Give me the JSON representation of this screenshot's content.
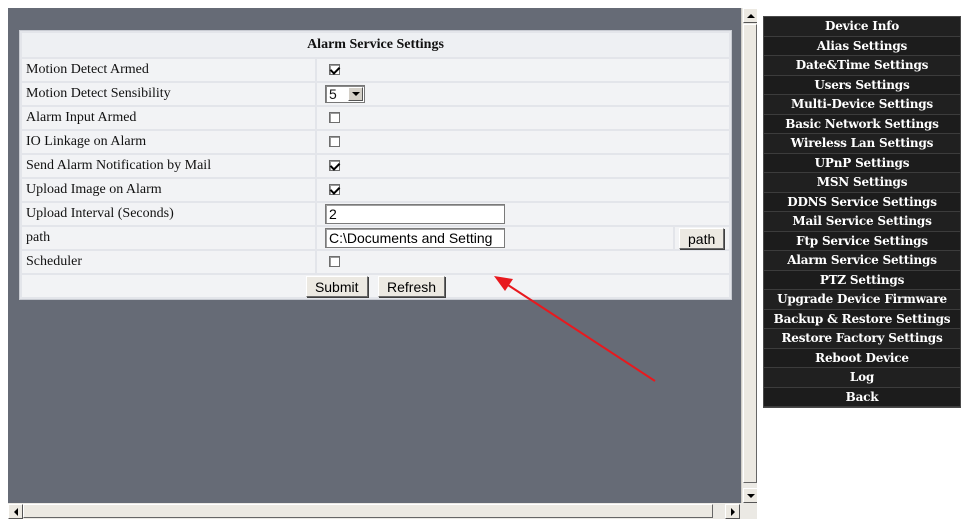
{
  "form": {
    "title": "Alarm Service Settings",
    "rows": {
      "motion_armed": {
        "label": "Motion Detect Armed",
        "checked": true
      },
      "sensibility": {
        "label": "Motion Detect Sensibility",
        "value": "5"
      },
      "alarm_input": {
        "label": "Alarm Input Armed",
        "checked": false
      },
      "io_linkage": {
        "label": "IO Linkage on Alarm",
        "checked": false
      },
      "send_mail": {
        "label": "Send Alarm Notification by Mail",
        "checked": true
      },
      "upload_image": {
        "label": "Upload Image on Alarm",
        "checked": true
      },
      "upload_interval": {
        "label": "Upload Interval (Seconds)",
        "value": "2"
      },
      "path": {
        "label": "path",
        "value": "C:\\Documents and Setting",
        "button": "path"
      },
      "scheduler": {
        "label": "Scheduler",
        "checked": false
      }
    },
    "submit_label": "Submit",
    "refresh_label": "Refresh"
  },
  "sidebar": {
    "items": [
      "Device Info",
      "Alias Settings",
      "Date&Time Settings",
      "Users Settings",
      "Multi-Device Settings",
      "Basic Network Settings",
      "Wireless Lan Settings",
      "UPnP Settings",
      "MSN Settings",
      "DDNS Service Settings",
      "Mail Service Settings",
      "Ftp Service Settings",
      "Alarm Service Settings",
      "PTZ Settings",
      "Upgrade Device Firmware",
      "Backup & Restore Settings",
      "Restore Factory Settings",
      "Reboot Device",
      "Log",
      "Back"
    ]
  },
  "colors": {
    "content_bg": "#666b76",
    "menu_bg": "#1c1c1c",
    "annotation_arrow": "#e8191e"
  }
}
